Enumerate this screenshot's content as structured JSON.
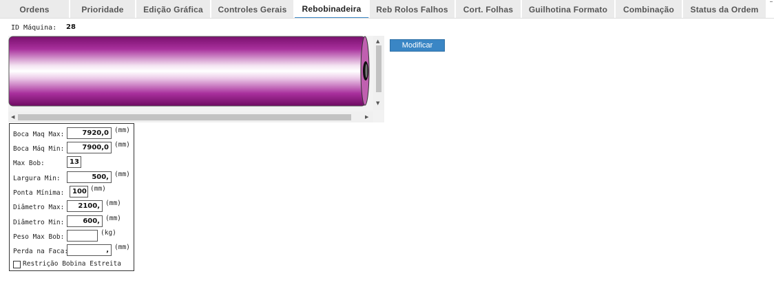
{
  "tabs": [
    {
      "label": "Ordens"
    },
    {
      "label": "Prioridade"
    },
    {
      "label": "Edição Gráfica"
    },
    {
      "label": "Controles Gerais"
    },
    {
      "label": "Rebobinadeira"
    },
    {
      "label": "Reb Rolos Falhos"
    },
    {
      "label": "Cort. Folhas"
    },
    {
      "label": "Guilhotina Formato"
    },
    {
      "label": "Combinação"
    },
    {
      "label": "Status da Ordem"
    }
  ],
  "active_tab": "Rebobinadeira",
  "machine": {
    "id_label": "ID Máquina:",
    "id_value": "28"
  },
  "roll": {
    "color": "#a0208e"
  },
  "buttons": {
    "modify_label": "Modificar"
  },
  "fields": [
    {
      "label": "Boca Maq Max:",
      "value": "7920,0",
      "unit": "(mm)"
    },
    {
      "label": "Boca Máq Min:",
      "value": "7900,0",
      "unit": "(mm)"
    },
    {
      "label": "Max Bob:",
      "value": "13",
      "unit": ""
    },
    {
      "label": "Largura Min:",
      "value": "500,",
      "unit": "(mm)"
    },
    {
      "label": "Ponta Mínima:",
      "value": "100",
      "unit": "(mm)"
    },
    {
      "label": "Diâmetro Max:",
      "value": "2100,",
      "unit": "(mm)"
    },
    {
      "label": "Diâmetro Min:",
      "value": "600,",
      "unit": "(mm)"
    },
    {
      "label": "Peso Max Bob:",
      "value": "",
      "unit": "(kg)"
    },
    {
      "label": "Perda na Faca:",
      "value": ",",
      "unit": "(mm)"
    }
  ],
  "restriction": {
    "label": "Restrição Bobina Estreita",
    "checked": false
  }
}
